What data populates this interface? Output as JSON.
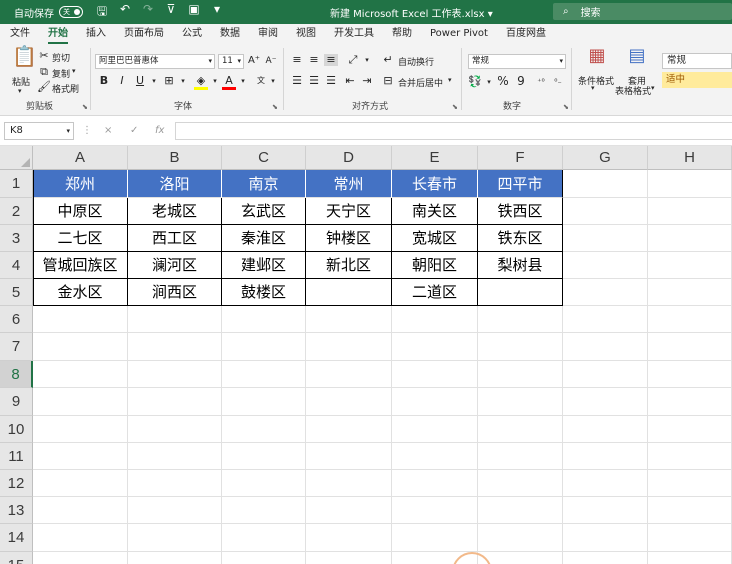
{
  "titlebar": {
    "autosave_label": "自动保存",
    "autosave_state": "关",
    "document_title": "新建 Microsoft Excel 工作表.xlsx",
    "search_placeholder": "搜索",
    "accent_color": "#217346"
  },
  "tabs": [
    "文件",
    "开始",
    "插入",
    "页面布局",
    "公式",
    "数据",
    "审阅",
    "视图",
    "开发工具",
    "帮助",
    "Power Pivot",
    "百度网盘"
  ],
  "active_tab": "开始",
  "ribbon": {
    "clipboard": {
      "paste": "粘贴",
      "cut": "剪切",
      "copy": "复制",
      "format_painter": "格式刷",
      "label": "剪贴板"
    },
    "font": {
      "font_name": "阿里巴巴普惠体",
      "font_size": "11",
      "label": "字体"
    },
    "alignment": {
      "wrap_text": "自动换行",
      "merge_center": "合并后居中",
      "label": "对齐方式"
    },
    "number": {
      "format": "常规",
      "percent": "%",
      "comma": "9",
      "label": "数字"
    },
    "styles": {
      "conditional_format": "条件格式",
      "table_format_1": "套用",
      "table_format_2": "表格格式",
      "style_normal": "常规",
      "style_neutral": "适中"
    }
  },
  "formula_bar": {
    "name_box": "K8",
    "fx": "fx",
    "cancel": "×",
    "confirm": "✓",
    "formula": ""
  },
  "columns": [
    "A",
    "B",
    "C",
    "D",
    "E",
    "F",
    "G",
    "H"
  ],
  "rows": [
    "1",
    "2",
    "3",
    "4",
    "5",
    "6",
    "7",
    "8",
    "9",
    "10",
    "11",
    "12",
    "13",
    "14",
    "15"
  ],
  "selected_row": "8",
  "table": {
    "header_color": "#4472c4",
    "headers": [
      "郑州",
      "洛阳",
      "南京",
      "常州",
      "长春市",
      "四平市"
    ],
    "body": [
      [
        "中原区",
        "老城区",
        "玄武区",
        "天宁区",
        "南关区",
        "铁西区"
      ],
      [
        "二七区",
        "西工区",
        "秦淮区",
        "钟楼区",
        "宽城区",
        "铁东区"
      ],
      [
        "管城回族区",
        "澜河区",
        "建邺区",
        "新北区",
        "朝阳区",
        "梨树县"
      ],
      [
        "金水区",
        "涧西区",
        "鼓楼区",
        "",
        "二道区",
        ""
      ]
    ]
  }
}
